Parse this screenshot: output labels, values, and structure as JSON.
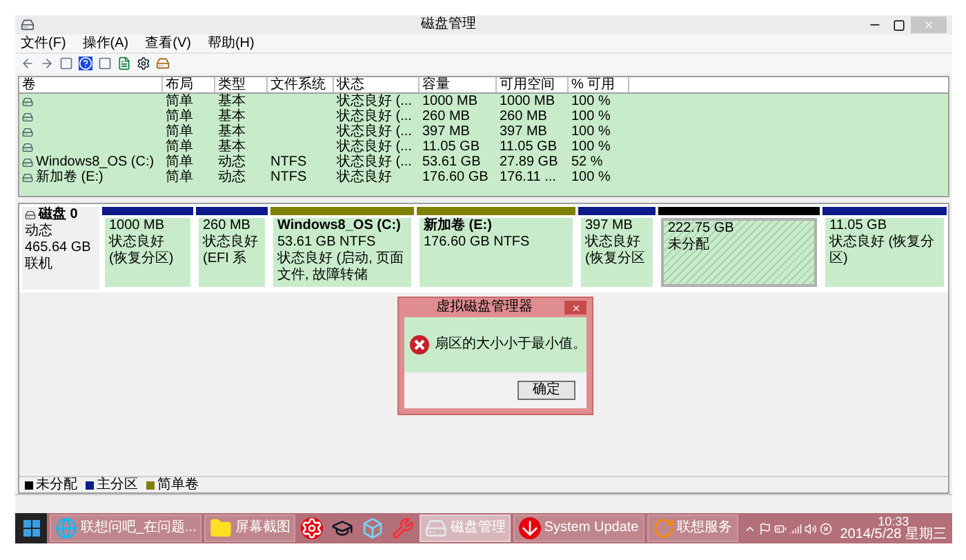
{
  "window": {
    "title": "磁盘管理"
  },
  "menu": [
    "文件(F)",
    "操作(A)",
    "查看(V)",
    "帮助(H)"
  ],
  "volume_table": {
    "columns": [
      "卷",
      "布局",
      "类型",
      "文件系统",
      "状态",
      "容量",
      "可用空间",
      "% 可用"
    ],
    "rows": [
      {
        "layout": "简单",
        "type": "基本",
        "status": "状态良好 (...",
        "capacity": "1000 MB",
        "free": "1000 MB",
        "percent": "100 %"
      },
      {
        "layout": "简单",
        "type": "基本",
        "status": "状态良好 (...",
        "capacity": "260 MB",
        "free": "260 MB",
        "percent": "100 %"
      },
      {
        "layout": "简单",
        "type": "基本",
        "status": "状态良好 (...",
        "capacity": "397 MB",
        "free": "397 MB",
        "percent": "100 %"
      },
      {
        "layout": "简单",
        "type": "基本",
        "status": "状态良好 (...",
        "capacity": "11.05 GB",
        "free": "11.05 GB",
        "percent": "100 %"
      },
      {
        "volume": "Windows8_OS (C:)",
        "layout": "简单",
        "type": "动态",
        "file_system": "NTFS",
        "status": "状态良好 (...",
        "capacity": "53.61 GB",
        "free": "27.89 GB",
        "percent": "52 %"
      },
      {
        "volume": "新加卷 (E:)",
        "layout": "简单",
        "type": "动态",
        "file_system": "NTFS",
        "status": "状态良好",
        "capacity": "176.60 GB",
        "free": "176.11 ...",
        "percent": "100 %"
      }
    ]
  },
  "disk": {
    "name": "磁盘 0",
    "type": "动态",
    "size": "465.64 GB",
    "status": "联机",
    "partitions": [
      {
        "kind": "volume",
        "color": "#0c1a8a",
        "size": "1000 MB",
        "status": "状态良好 (恢复分区)"
      },
      {
        "kind": "volume",
        "color": "#0c1a8a",
        "size": "260 MB",
        "status": "状态良好 (EFI 系"
      },
      {
        "kind": "volume",
        "color": "#808000",
        "title": "Windows8_OS  (C:)",
        "size": "53.61 GB NTFS",
        "status": "状态良好 (启动, 页面文件, 故障转储"
      },
      {
        "kind": "volume",
        "color": "#808000",
        "title": "新加卷  (E:)",
        "size": "176.60 GB NTFS"
      },
      {
        "kind": "volume",
        "color": "#0c1a8a",
        "size": "397 MB",
        "status": "状态良好 (恢复分区"
      },
      {
        "kind": "unallocated",
        "color": "#000000",
        "size": "222.75 GB",
        "status": "未分配"
      },
      {
        "kind": "volume",
        "color": "#0c1a8a",
        "size": "11.05 GB",
        "status": "状态良好 (恢复分区)"
      }
    ]
  },
  "legend": [
    {
      "label": "未分配",
      "color": "#000000"
    },
    {
      "label": "主分区",
      "color": "#0c1a8a"
    },
    {
      "label": "简单卷",
      "color": "#808000"
    }
  ],
  "dialog": {
    "title": "虚拟磁盘管理器",
    "message": "扇区的大小小于最小值。",
    "button": "确定"
  },
  "taskbar": {
    "buttons": [
      {
        "kind": "browser",
        "label": "联想问吧_在问题...",
        "selected": false
      },
      {
        "kind": "folder",
        "label": "屏幕截图",
        "selected": false
      },
      {
        "kind": "pinned-red",
        "selected": false
      },
      {
        "kind": "pinned-cap",
        "selected": false
      },
      {
        "kind": "pinned-cube",
        "selected": false
      },
      {
        "kind": "pinned-tool",
        "selected": false
      },
      {
        "kind": "disk",
        "label": "磁盘管理",
        "selected": true
      },
      {
        "kind": "update",
        "label": "System Update",
        "selected": false
      },
      {
        "kind": "service",
        "label": "联想服务",
        "selected": false
      }
    ],
    "time": "10:33",
    "date": "2014/5/28 星期三"
  }
}
